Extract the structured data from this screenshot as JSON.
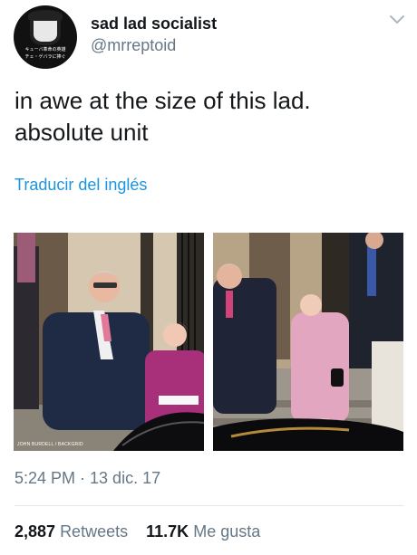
{
  "author": {
    "display_name": "sad lad socialist",
    "handle": "@mrreptoid",
    "avatar_text_line1": "キューバ革命の英雄",
    "avatar_text_line2": "チェ・ゲバラに捧ぐ"
  },
  "tweet": {
    "text": "in awe at the size of this lad. absolute unit",
    "translate_link": "Traducir del inglés"
  },
  "media": {
    "photo_credit": "JOHN BURDELL / BACKGRID"
  },
  "meta": {
    "timestamp": "5:24 PM · 13 dic. 17"
  },
  "stats": {
    "retweets_count": "2,887",
    "retweets_label": "Retweets",
    "likes_count": "11.7K",
    "likes_label": "Me gusta"
  },
  "icons": {
    "caret": "chevron-down-icon"
  },
  "colors": {
    "link": "#1b95e0",
    "secondary_text": "#657786",
    "primary_text": "#14171a",
    "divider": "#e1e8ed"
  }
}
